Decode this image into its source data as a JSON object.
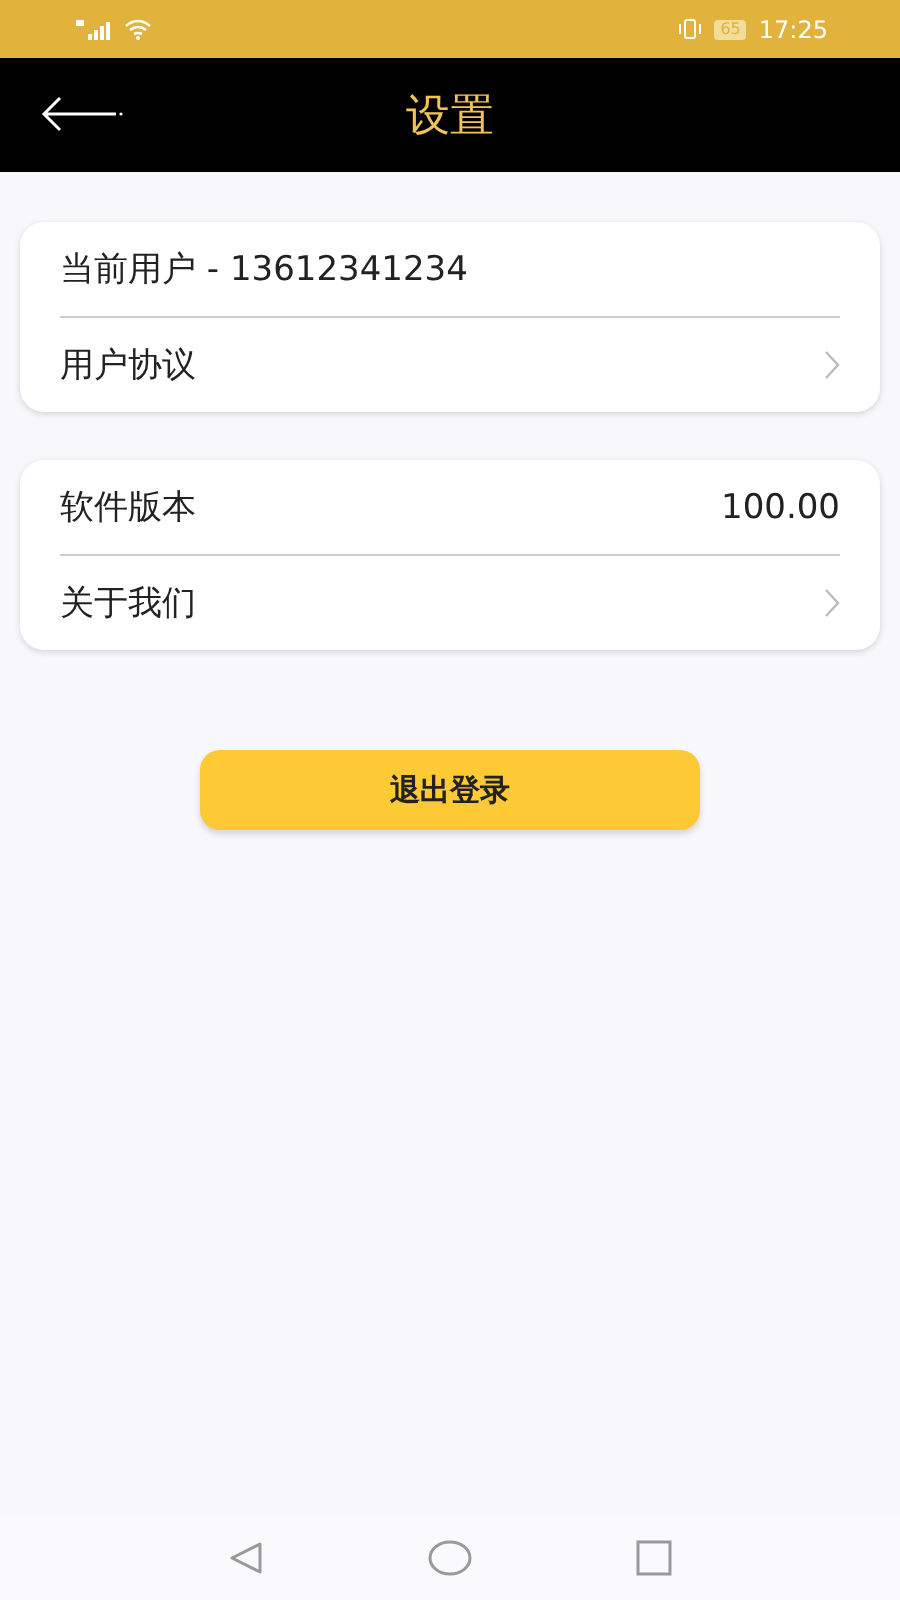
{
  "status_bar": {
    "battery": "65",
    "time": "17:25"
  },
  "header": {
    "title": "设置"
  },
  "groups": [
    {
      "rows": [
        {
          "kind": "text",
          "label": "当前用户  -  13612341234"
        },
        {
          "kind": "link",
          "label": "用户协议"
        }
      ]
    },
    {
      "rows": [
        {
          "kind": "value",
          "label": "软件版本",
          "value": "100.00"
        },
        {
          "kind": "link",
          "label": "关于我们"
        }
      ]
    }
  ],
  "logout_button": "退出登录"
}
